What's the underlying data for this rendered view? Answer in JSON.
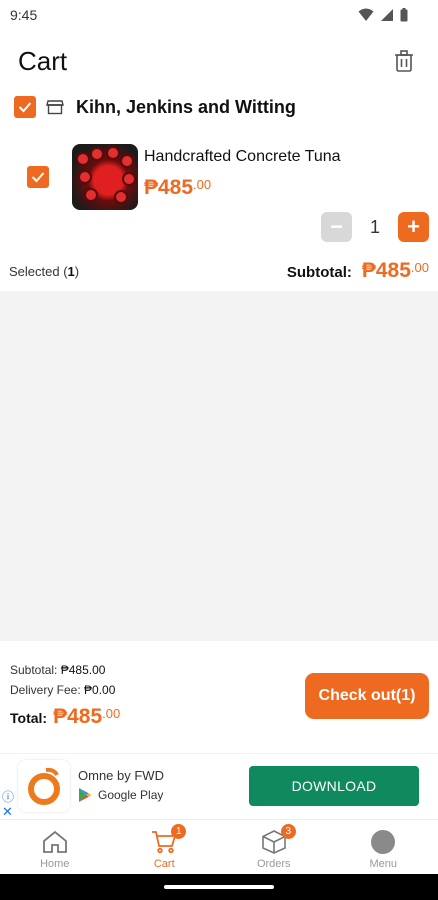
{
  "status": {
    "time": "9:45"
  },
  "header": {
    "title": "Cart",
    "delete_icon": "trash-icon"
  },
  "store": {
    "name": "Kihn, Jenkins and Witting",
    "icon": "store-icon"
  },
  "item": {
    "name": "Handcrafted Concrete Tuna",
    "price_main": "₱485",
    "price_cents": ".00",
    "quantity": "1",
    "minus_label": "−",
    "plus_label": "+"
  },
  "selection": {
    "label": "Selected (",
    "count": "1",
    "close": ")",
    "subtotal_label": "Subtotal:",
    "subtotal_main": "₱485",
    "subtotal_cents": ".00"
  },
  "summary": {
    "subtotal_label": "Subtotal:",
    "subtotal_value": "₱485.00",
    "delivery_label": "Delivery Fee:",
    "delivery_value": "₱0.00",
    "total_label": "Total:",
    "total_main": "₱485",
    "total_cents": ".00",
    "checkout_label": "Check out(1)"
  },
  "ad": {
    "app_name": "Omne by FWD",
    "store_name": "Google Play",
    "download_label": "DOWNLOAD",
    "info_glyph": "ⓘ",
    "close_glyph": "✕"
  },
  "nav": {
    "items": [
      {
        "label": "Home",
        "icon": "home-icon",
        "badge": ""
      },
      {
        "label": "Cart",
        "icon": "cart-icon",
        "badge": "1"
      },
      {
        "label": "Orders",
        "icon": "box-icon",
        "badge": "3"
      },
      {
        "label": "Menu",
        "icon": "menu-avatar-icon",
        "badge": ""
      }
    ]
  },
  "colors": {
    "accent": "#ee6a20",
    "download": "#0f8a5f",
    "empty_bg": "#f3f3f3"
  }
}
